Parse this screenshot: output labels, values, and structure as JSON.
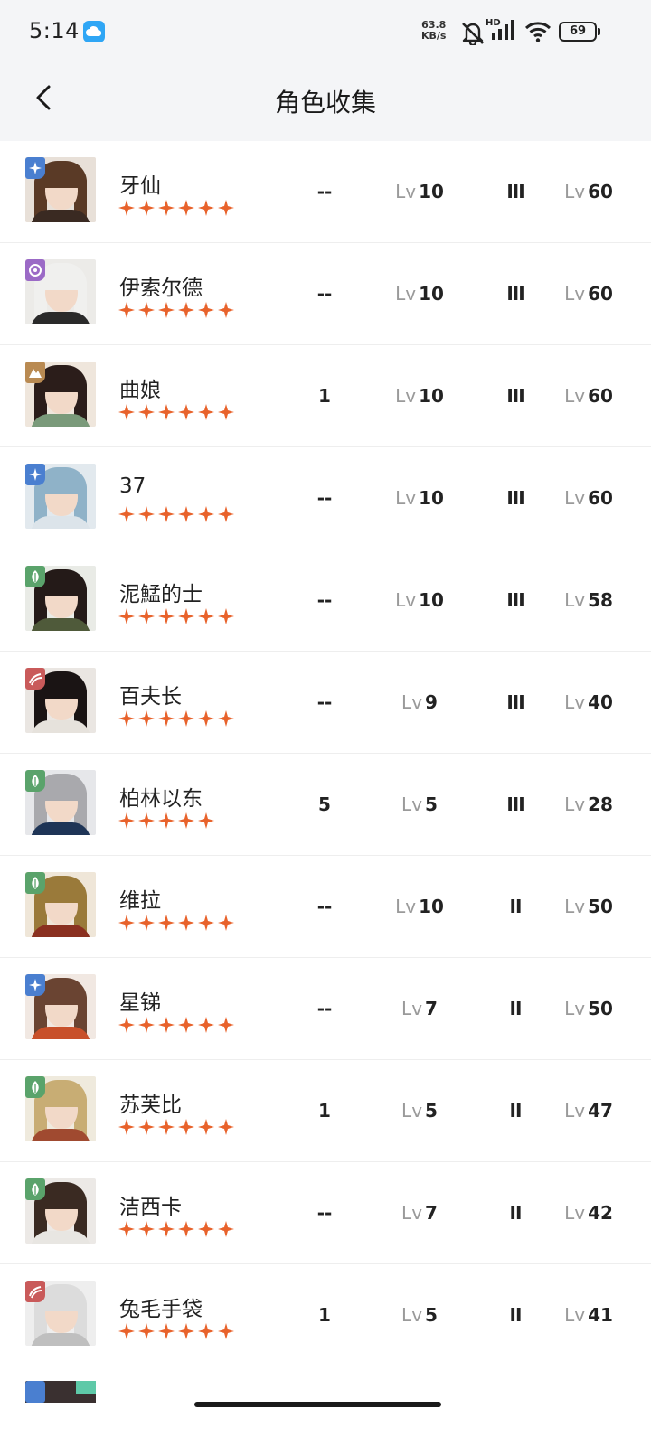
{
  "status_bar": {
    "time": "5:14",
    "net_speed_value": "63.8",
    "net_speed_unit": "KB/s",
    "signal_label": "HD",
    "battery": "69"
  },
  "header": {
    "title": "角色收集"
  },
  "colors": {
    "star": "#e8622b",
    "element_blue": "#4a7fd0",
    "element_purple": "#9b6ac6",
    "element_tan": "#b98a52",
    "element_green": "#5aa36b",
    "element_red": "#c95a5a"
  },
  "characters": [
    {
      "name": "牙仙",
      "element_icon": "star-compass-icon",
      "stars": 6,
      "rank": "--",
      "lv_label": "Lv",
      "level": "10",
      "tier": "III",
      "lv2_label": "Lv",
      "level2": "60"
    },
    {
      "name": "伊索尔德",
      "element_icon": "moon-icon",
      "stars": 6,
      "rank": "--",
      "lv_label": "Lv",
      "level": "10",
      "tier": "III",
      "lv2_label": "Lv",
      "level2": "60"
    },
    {
      "name": "曲娘",
      "element_icon": "mountain-icon",
      "stars": 6,
      "rank": "1",
      "lv_label": "Lv",
      "level": "10",
      "tier": "III",
      "lv2_label": "Lv",
      "level2": "60"
    },
    {
      "name": "37",
      "element_icon": "star-compass-icon",
      "stars": 6,
      "rank": "--",
      "lv_label": "Lv",
      "level": "10",
      "tier": "III",
      "lv2_label": "Lv",
      "level2": "60"
    },
    {
      "name": "泥鯭的士",
      "element_icon": "leaf-icon",
      "stars": 6,
      "rank": "--",
      "lv_label": "Lv",
      "level": "10",
      "tier": "III",
      "lv2_label": "Lv",
      "level2": "58"
    },
    {
      "name": "百夫长",
      "element_icon": "wave-icon",
      "stars": 6,
      "rank": "--",
      "lv_label": "Lv",
      "level": "9",
      "tier": "III",
      "lv2_label": "Lv",
      "level2": "40"
    },
    {
      "name": "柏林以东",
      "element_icon": "leaf-icon",
      "stars": 5,
      "rank": "5",
      "lv_label": "Lv",
      "level": "5",
      "tier": "III",
      "lv2_label": "Lv",
      "level2": "28"
    },
    {
      "name": "维拉",
      "element_icon": "leaf-icon",
      "stars": 6,
      "rank": "--",
      "lv_label": "Lv",
      "level": "10",
      "tier": "II",
      "lv2_label": "Lv",
      "level2": "50"
    },
    {
      "name": "星锑",
      "element_icon": "star-compass-icon",
      "stars": 6,
      "rank": "--",
      "lv_label": "Lv",
      "level": "7",
      "tier": "II",
      "lv2_label": "Lv",
      "level2": "50"
    },
    {
      "name": "苏芙比",
      "element_icon": "leaf-icon",
      "stars": 6,
      "rank": "1",
      "lv_label": "Lv",
      "level": "5",
      "tier": "II",
      "lv2_label": "Lv",
      "level2": "47"
    },
    {
      "name": "洁西卡",
      "element_icon": "leaf-icon",
      "stars": 6,
      "rank": "--",
      "lv_label": "Lv",
      "level": "7",
      "tier": "II",
      "lv2_label": "Lv",
      "level2": "42"
    },
    {
      "name": "兔毛手袋",
      "element_icon": "wave-icon",
      "stars": 6,
      "rank": "1",
      "lv_label": "Lv",
      "level": "5",
      "tier": "II",
      "lv2_label": "Lv",
      "level2": "41"
    }
  ]
}
